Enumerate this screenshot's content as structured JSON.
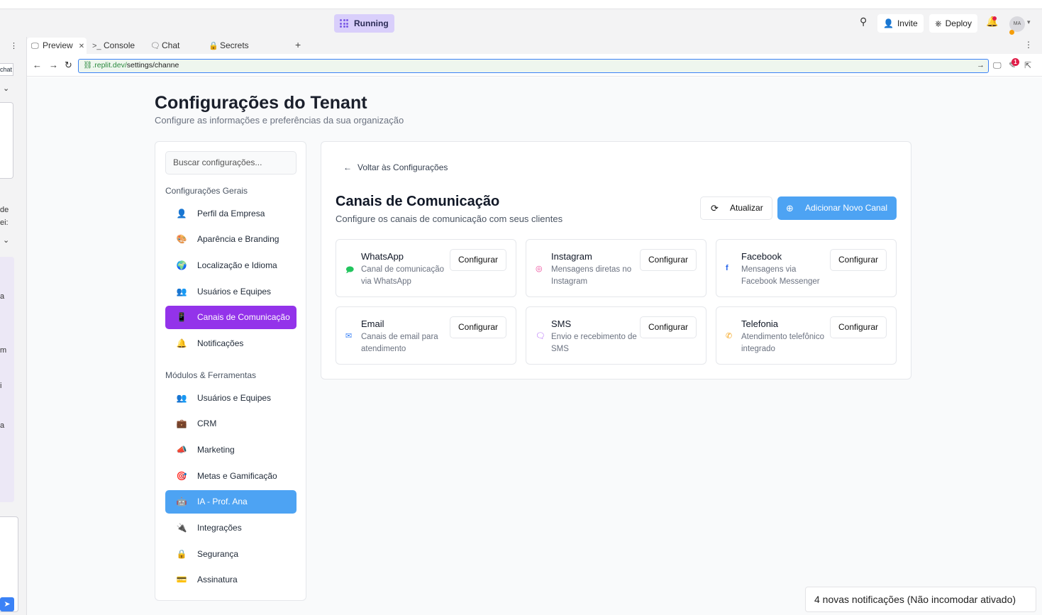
{
  "topbar": {
    "running_label": "Running",
    "invite_label": "Invite",
    "deploy_label": "Deploy",
    "avatar_initials": "MA"
  },
  "tabs": [
    {
      "label": "Preview",
      "icon": "monitor-icon"
    },
    {
      "label": "Console",
      "icon": "terminal-icon"
    },
    {
      "label": "Chat",
      "icon": "chat-icon"
    },
    {
      "label": "Secrets",
      "icon": "lock-icon"
    }
  ],
  "url": {
    "host": ".replit.dev/",
    "path": "settings/channe"
  },
  "url_badge": "1",
  "left_strip": {
    "chat_label": "chat",
    "fragments": [
      "de",
      "ei:",
      "a",
      "m",
      "i",
      "a"
    ]
  },
  "page": {
    "title": "Configurações do Tenant",
    "subtitle": "Configure as informações e preferências da sua organização"
  },
  "sidebar": {
    "search_placeholder": "Buscar configurações...",
    "general_heading": "Configurações Gerais",
    "general_items": [
      {
        "label": "Perfil da Empresa",
        "icon": "person-icon"
      },
      {
        "label": "Aparência e Branding",
        "icon": "palette-icon"
      },
      {
        "label": "Localização e Idioma",
        "icon": "globe-icon"
      },
      {
        "label": "Usuários e Equipes",
        "icon": "users-icon"
      },
      {
        "label": "Canais de Comunicação",
        "icon": "phone-icon"
      },
      {
        "label": "Notificações",
        "icon": "bell-icon"
      }
    ],
    "modules_heading": "Módulos & Ferramentas",
    "module_items": [
      {
        "label": "Usuários e Equipes",
        "icon": "users-icon"
      },
      {
        "label": "CRM",
        "icon": "briefcase-icon"
      },
      {
        "label": "Marketing",
        "icon": "megaphone-icon"
      },
      {
        "label": "Metas e Gamificação",
        "icon": "target-icon"
      },
      {
        "label": "IA - Prof. Ana",
        "icon": "robot-icon"
      },
      {
        "label": "Integrações",
        "icon": "plug-icon"
      },
      {
        "label": "Segurança",
        "icon": "lock-icon"
      },
      {
        "label": "Assinatura",
        "icon": "card-icon"
      }
    ]
  },
  "content": {
    "back_label": "Voltar às Configurações",
    "title": "Canais de Comunicação",
    "subtitle": "Configure os canais de comunicação com seus clientes",
    "refresh_label": "Atualizar",
    "add_label": "Adicionar Novo Canal",
    "channels": [
      {
        "name": "WhatsApp",
        "desc": "Canal de comunicação via WhatsApp",
        "button": "Configurar",
        "icon": "message-icon",
        "color": "#22c55e"
      },
      {
        "name": "Instagram",
        "desc": "Mensagens diretas no Instagram",
        "button": "Configurar",
        "icon": "instagram-icon",
        "color": "#ec4899"
      },
      {
        "name": "Facebook",
        "desc": "Mensagens via Facebook Messenger",
        "button": "Configurar",
        "icon": "facebook-icon",
        "color": "#2563eb"
      },
      {
        "name": "Email",
        "desc": "Canais de email para atendimento",
        "button": "Configurar",
        "icon": "mail-icon",
        "color": "#3b82f6"
      },
      {
        "name": "SMS",
        "desc": "Envio e recebimento de SMS",
        "button": "Configurar",
        "icon": "sms-icon",
        "color": "#a855f7"
      },
      {
        "name": "Telefonia",
        "desc": "Atendimento telefônico integrado",
        "button": "Configurar",
        "icon": "phone-icon",
        "color": "#f59e0b"
      }
    ]
  },
  "toast": "4 novas notificações (Não incomodar ativado)",
  "colors": {
    "active_purple": "#9333ea",
    "active_blue": "#4da3f3",
    "primary_button": "#4da3f3"
  }
}
